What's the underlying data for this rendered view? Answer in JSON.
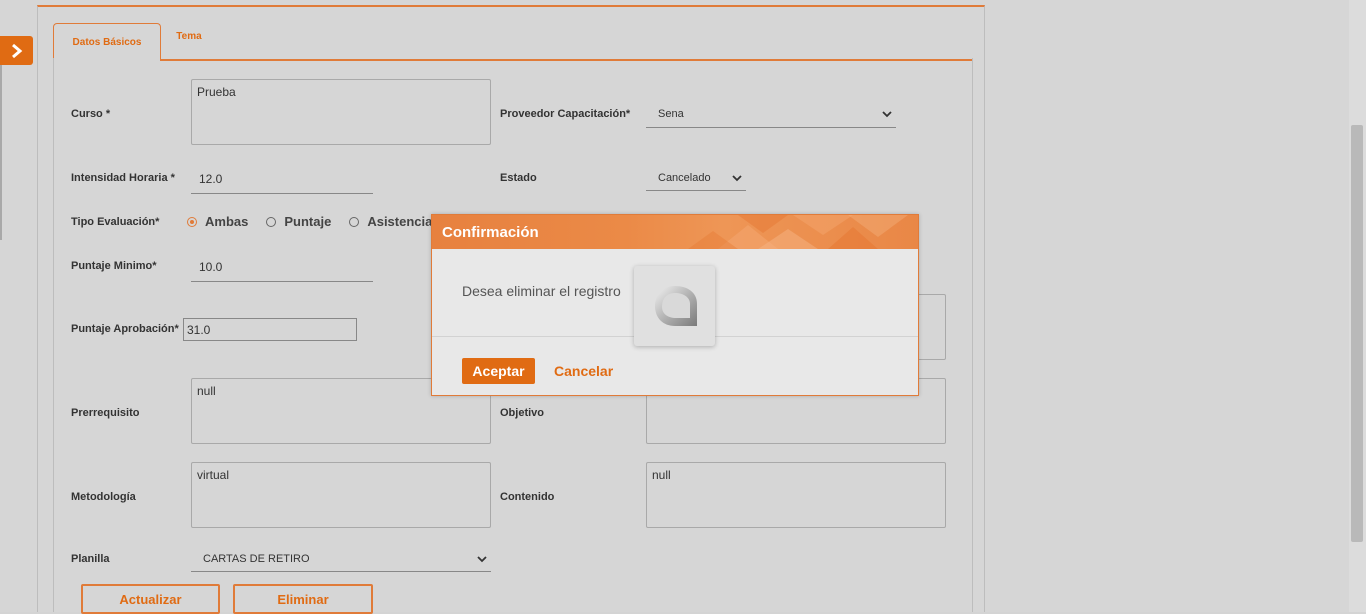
{
  "tabs": [
    {
      "label": "Datos Básicos",
      "active": true
    },
    {
      "label": "Tema",
      "active": false
    }
  ],
  "form": {
    "curso": {
      "label": "Curso *",
      "value": "Prueba"
    },
    "intensidad": {
      "label": "Intensidad Horaria *",
      "value": "12.0"
    },
    "tipo_evaluacion": {
      "label": "Tipo Evaluación*",
      "options": [
        "Ambas",
        "Puntaje",
        "Asistencia"
      ],
      "selected": "Ambas"
    },
    "puntaje_minimo": {
      "label": "Puntaje Minimo*",
      "value": "10.0"
    },
    "puntaje_aprobacion": {
      "label": "Puntaje Aprobación*",
      "value": "31.0"
    },
    "prerrequisito": {
      "label": "Prerrequisito",
      "value": "null"
    },
    "metodologia": {
      "label": "Metodología",
      "value": "virtual"
    },
    "planilla": {
      "label": "Planilla",
      "value": "CARTAS DE RETIRO"
    },
    "proveedor": {
      "label": "Proveedor Capacitación*",
      "value": "Sena"
    },
    "estado": {
      "label": "Estado",
      "value": "Cancelado"
    },
    "objetivo": {
      "label": "Objetivo",
      "value": ""
    },
    "contenido": {
      "label": "Contenido",
      "value": "null"
    }
  },
  "actions": {
    "actualizar": "Actualizar",
    "eliminar": "Eliminar"
  },
  "modal": {
    "title": "Confirmación",
    "message": "Desea eliminar el registro",
    "accept": "Aceptar",
    "cancel": "Cancelar"
  },
  "colors": {
    "accent": "#e06b13",
    "accent_border": "#e07b39",
    "background": "#d6d6d6"
  },
  "icons": {
    "side_toggle": "chevron-right-icon",
    "select_arrow": "chevron-down-icon",
    "loader": "app-logo-loader-icon"
  }
}
